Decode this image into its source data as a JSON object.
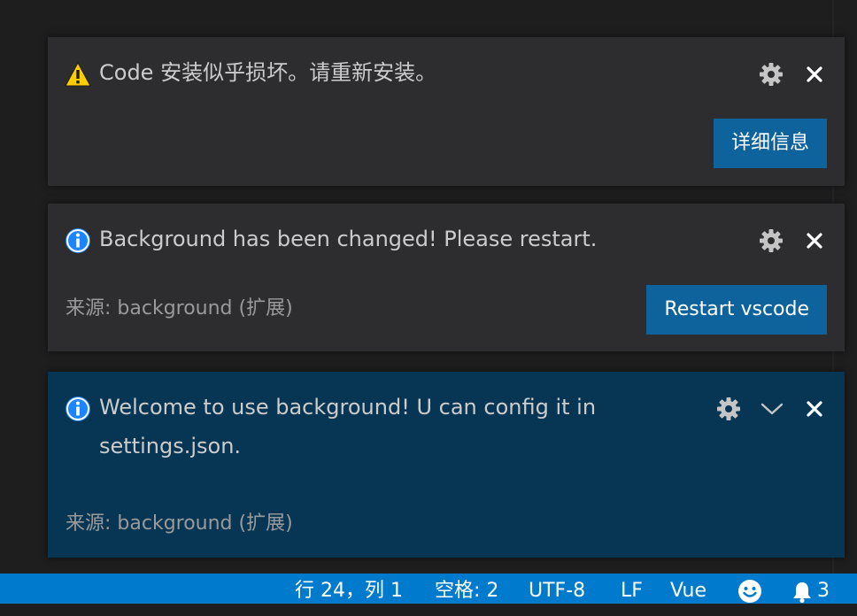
{
  "notifications": [
    {
      "type": "warning",
      "message": "Code 安装似乎损坏。请重新安装。",
      "source": "",
      "action_label": "详细信息"
    },
    {
      "type": "info",
      "message": "Background has been changed! Please restart.",
      "source": "来源: background (扩展)",
      "action_label": "Restart vscode"
    },
    {
      "type": "info",
      "message": "Welcome to use background! U can config it in settings.json.",
      "source": "来源: background (扩展)",
      "action_label": ""
    }
  ],
  "icons": {
    "warning": "warning-icon",
    "info": "info-icon",
    "settings": "gear-icon",
    "close": "close-icon",
    "expand": "chevron-down-icon",
    "feedback": "smiley-icon",
    "notifications": "bell-icon"
  },
  "statusbar": {
    "position": "行 24，列 1",
    "indentation": "空格: 2",
    "encoding": "UTF-8",
    "eol": "LF",
    "language": "Vue",
    "notification_count": "3"
  },
  "colors": {
    "statusbar": "#007acc",
    "button": "#0e639c",
    "toast": "#2d2d30",
    "toast_focused": "#073655",
    "warning": "#ffcc00",
    "info": "#1a85ff"
  }
}
